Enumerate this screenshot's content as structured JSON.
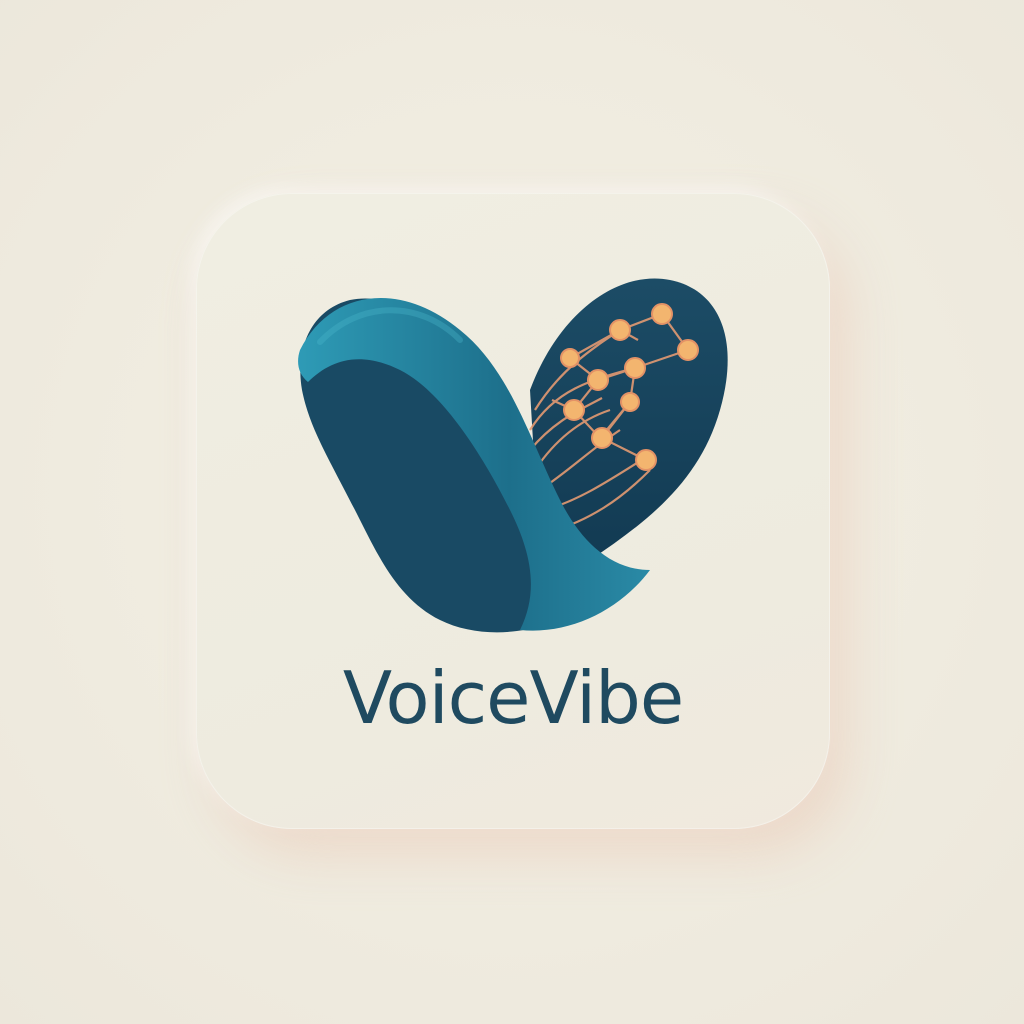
{
  "app_icon": {
    "name": "VoiceVibe",
    "logo_icon": "v-wave-network-icon",
    "colors": {
      "background": "#efebdf",
      "tile": "#eeebdf",
      "teal": "#2a8fa8",
      "navy": "#1b4a63",
      "accent": "#f1b070",
      "wordmark": "#1f4a60"
    }
  }
}
